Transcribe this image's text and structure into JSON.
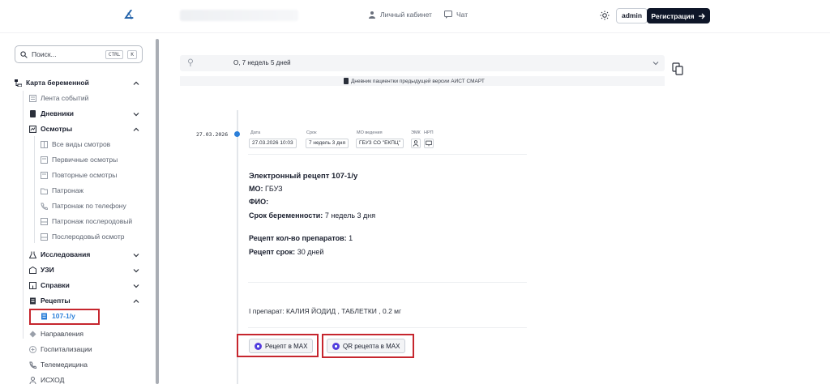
{
  "header": {
    "logo": "∡",
    "cabinet_label": "Личный кабинет",
    "chat_label": "Чат",
    "admin_label": "admin",
    "register_label": "Регистрация"
  },
  "sidebar": {
    "search_placeholder": "Поиск...",
    "search_kbd_ctrl": "CTRL",
    "search_kbd_k": "K",
    "items": [
      {
        "label": "Карта беременной"
      },
      {
        "label": "Лента событий"
      },
      {
        "label": "Дневники"
      },
      {
        "label": "Осмотры"
      },
      {
        "label": "Все виды смотров"
      },
      {
        "label": "Первичные осмотры"
      },
      {
        "label": "Повторные осмотры"
      },
      {
        "label": "Патронаж"
      },
      {
        "label": "Патронаж по телефону"
      },
      {
        "label": "Патронаж послеродовый"
      },
      {
        "label": "Послеродовый осмотр"
      },
      {
        "label": "Исследования"
      },
      {
        "label": "УЗИ"
      },
      {
        "label": "Справки"
      },
      {
        "label": "Рецепты"
      },
      {
        "label": "107-1/у"
      },
      {
        "label": "Направления"
      },
      {
        "label": "Госпитализации"
      },
      {
        "label": "Телемедицина"
      },
      {
        "label": "ИСХОД"
      }
    ]
  },
  "main": {
    "pregnancy_term": "О, 7 недель 5 дней",
    "diary_note": "Дневник пациентки предыдущей версии АИСТ СМАРТ",
    "entry": {
      "date": "27.03.2026",
      "labels": {
        "date": "Дата",
        "term": "Срок",
        "mo": "МО ведения",
        "emk": "ЭМК",
        "nrp": "НРП"
      },
      "date_value": "27.03.2026 10:03",
      "term_value": "7 недель 3 дня",
      "mo_value": "ГБУЗ СО \"ЕКПЦ\""
    },
    "recipe": {
      "title": "Электронный рецепт 107-1/у",
      "mo_label": "МО:",
      "mo_value": "ГБУЗ",
      "fio_label": "ФИО:",
      "term_label": "Срок беременности:",
      "term_value": "7 недель 3 дня",
      "count_label": "Рецепт кол-во препаратов:",
      "count_value": "1",
      "duration_label": "Рецепт срок:",
      "duration_value": "30 дней",
      "drug_line": "I препарат: КАЛИЯ ЙОДИД , ТАБЛЕТКИ , 0.2 мг"
    },
    "buttons": {
      "max_label": "Рецепт в MAX",
      "qr_label": "QR рецепта в MAX"
    }
  },
  "colors": {
    "accent": "#2b7fd9",
    "dark": "#0e1628",
    "highlight": "#c6262e"
  }
}
